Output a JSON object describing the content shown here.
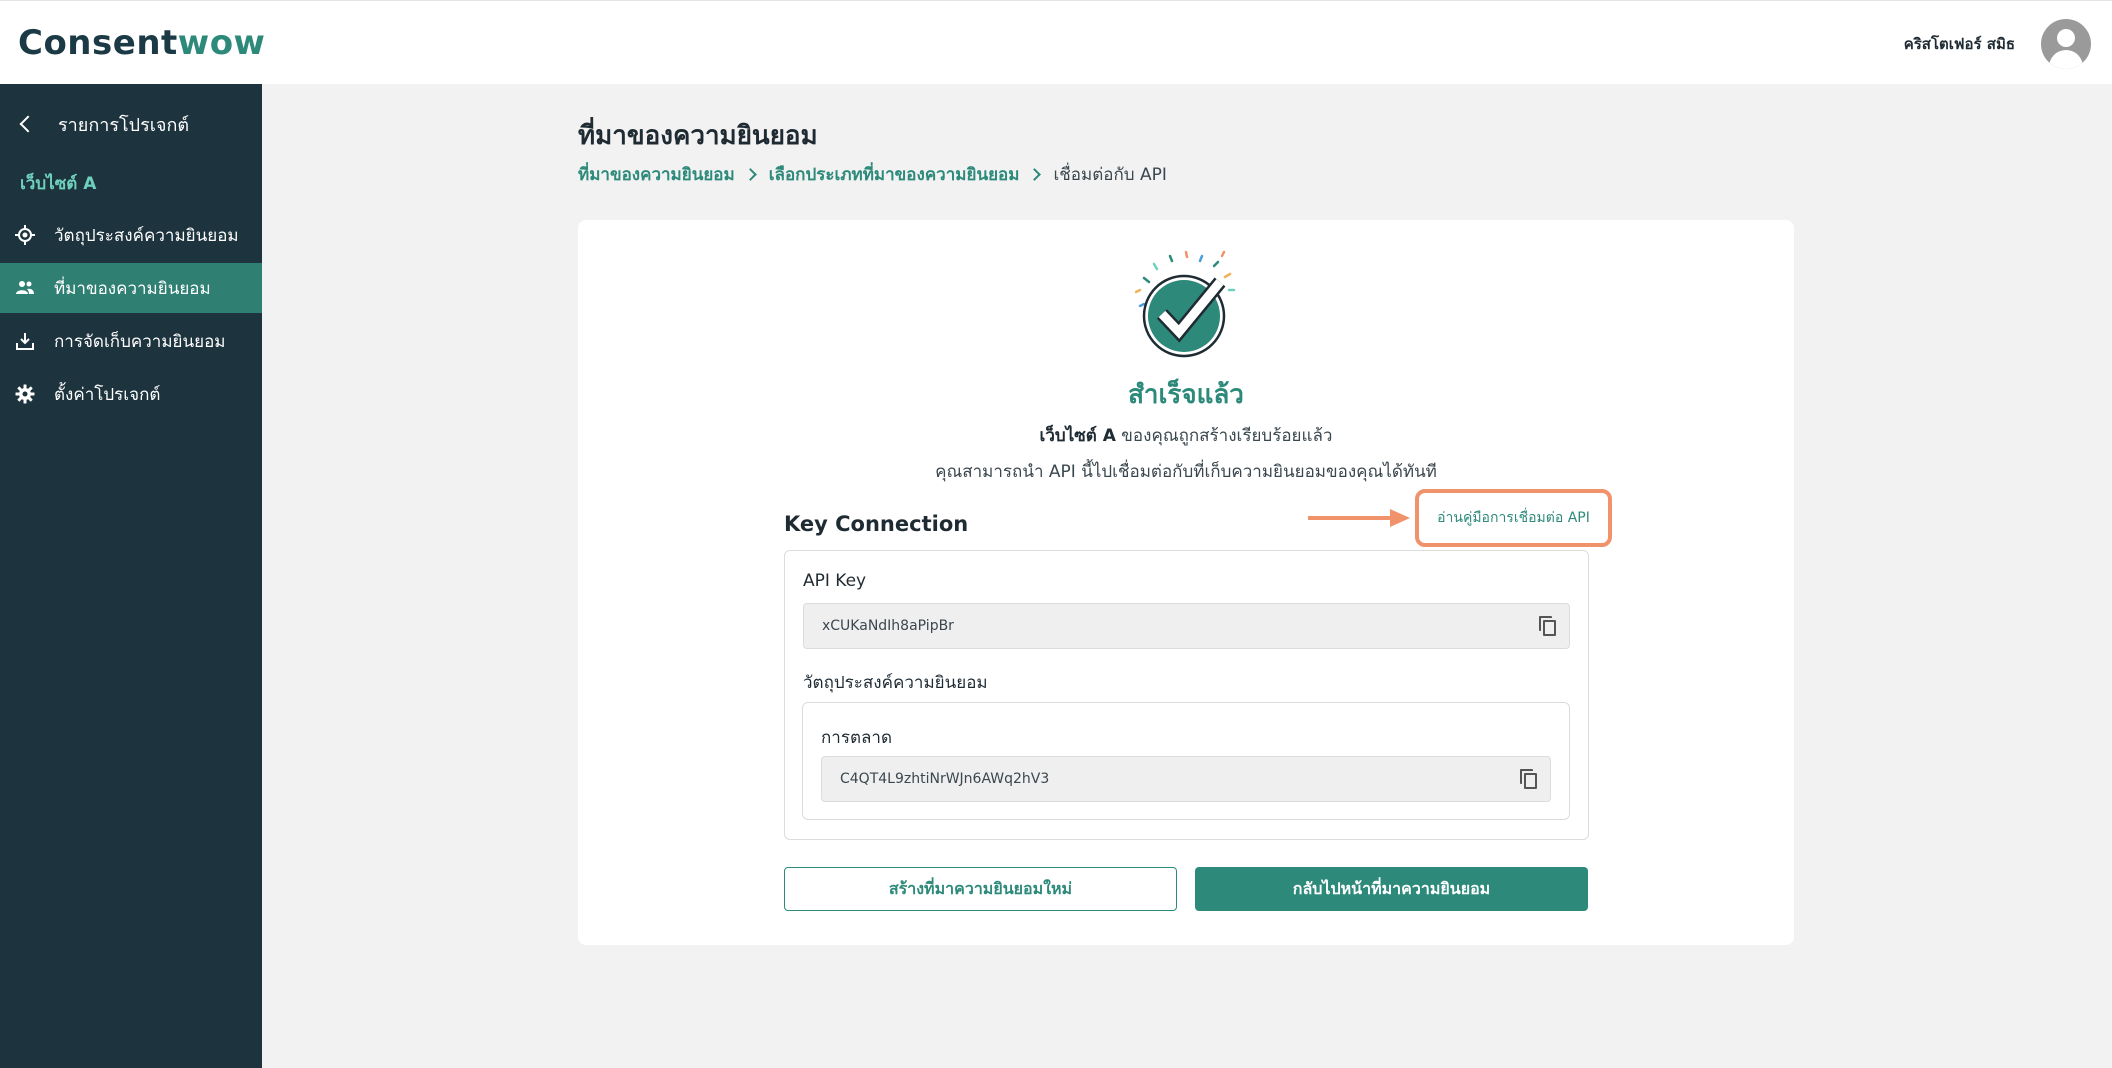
{
  "header": {
    "logo_part1": "Consent",
    "logo_part2": "wow",
    "user_name": "คริสโตเฟอร์ สมิธ"
  },
  "sidebar": {
    "back_label": "รายการโปรเจกต์",
    "project_name": "เว็บไซต์ A",
    "items": [
      {
        "label": "วัตถุประสงค์ความยินยอม",
        "icon": "target-icon",
        "active": false
      },
      {
        "label": "ที่มาของความยินยอม",
        "icon": "people-icon",
        "active": true
      },
      {
        "label": "การจัดเก็บความยินยอม",
        "icon": "download-icon",
        "active": false
      },
      {
        "label": "ตั้งค่าโปรเจกต์",
        "icon": "gear-icon",
        "active": false
      }
    ]
  },
  "main": {
    "title": "ที่มาของความยินยอม",
    "breadcrumb": [
      "ที่มาของความยินยอม",
      "เลือกประเภทที่มาของความยินยอม",
      "เชื่อมต่อกับ API"
    ]
  },
  "success": {
    "title": "สำเร็จแล้ว",
    "site_name": "เว็บไซต์ A",
    "line1_rest": " ของคุณถูกสร้างเรียบร้อยแล้ว",
    "line2": "คุณสามารถนำ API นี้ไปเชื่อมต่อกับที่เก็บความยินยอมของคุณได้ทันที"
  },
  "key_connection": {
    "title": "Key Connection",
    "manual_link": "อ่านคู่มือการเชื่อมต่อ API",
    "api_key_label": "API Key",
    "api_key_value": "xCUKaNdIh8aPipBr",
    "purpose_label": "วัตถุประสงค์ความยินยอม",
    "purpose_name": "การตลาด",
    "purpose_key_value": "C4QT4L9zhtiNrWJn6AWq2hV3"
  },
  "buttons": {
    "create_new": "สร้างที่มาความยินยอมใหม่",
    "back_to_list": "กลับไปหน้าที่มาความยินยอม"
  },
  "colors": {
    "sidebar_bg": "#1d333d",
    "accent": "#2d8a7b",
    "highlight": "#f0926a"
  }
}
